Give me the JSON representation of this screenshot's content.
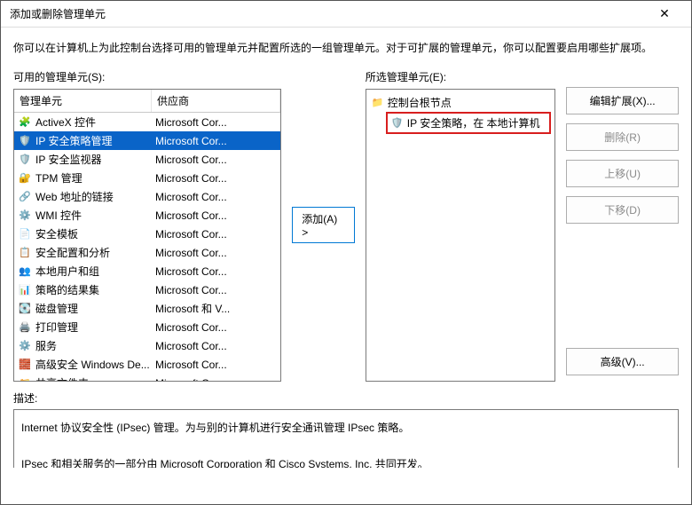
{
  "window": {
    "title": "添加或删除管理单元",
    "close_glyph": "✕"
  },
  "intro": "你可以在计算机上为此控制台选择可用的管理单元并配置所选的一组管理单元。对于可扩展的管理单元，你可以配置要启用哪些扩展项。",
  "left": {
    "label": "可用的管理单元(S):",
    "col_snapin": "管理单元",
    "col_vendor": "供应商",
    "items": [
      {
        "icon": "🧩",
        "name": "ActiveX 控件",
        "vendor": "Microsoft Cor..."
      },
      {
        "icon": "🛡️",
        "name": "IP 安全策略管理",
        "vendor": "Microsoft Cor...",
        "selected": true
      },
      {
        "icon": "🛡️",
        "name": "IP 安全监视器",
        "vendor": "Microsoft Cor..."
      },
      {
        "icon": "🔐",
        "name": "TPM 管理",
        "vendor": "Microsoft Cor..."
      },
      {
        "icon": "🔗",
        "name": "Web 地址的链接",
        "vendor": "Microsoft Cor..."
      },
      {
        "icon": "⚙️",
        "name": "WMI 控件",
        "vendor": "Microsoft Cor..."
      },
      {
        "icon": "📄",
        "name": "安全模板",
        "vendor": "Microsoft Cor..."
      },
      {
        "icon": "📋",
        "name": "安全配置和分析",
        "vendor": "Microsoft Cor..."
      },
      {
        "icon": "👥",
        "name": "本地用户和组",
        "vendor": "Microsoft Cor..."
      },
      {
        "icon": "📊",
        "name": "策略的结果集",
        "vendor": "Microsoft Cor..."
      },
      {
        "icon": "💽",
        "name": "磁盘管理",
        "vendor": "Microsoft 和 V..."
      },
      {
        "icon": "🖨️",
        "name": "打印管理",
        "vendor": "Microsoft Cor..."
      },
      {
        "icon": "⚙️",
        "name": "服务",
        "vendor": "Microsoft Cor..."
      },
      {
        "icon": "🧱",
        "name": "高级安全 Windows De...",
        "vendor": "Microsoft Cor..."
      },
      {
        "icon": "📁",
        "name": "共享文件夹",
        "vendor": "Microsoft Cor..."
      }
    ]
  },
  "add_button": "添加(A) >",
  "right": {
    "label": "所选管理单元(E):",
    "root_icon": "📁",
    "root": "控制台根节点",
    "child_icon": "🛡️",
    "child": "IP 安全策略，在 本地计算机"
  },
  "buttons": {
    "edit_ext": "编辑扩展(X)...",
    "remove": "删除(R)",
    "move_up": "上移(U)",
    "move_down": "下移(D)",
    "advanced": "高级(V)..."
  },
  "desc_label": "描述:",
  "desc_text": "Internet 协议安全性 (IPsec) 管理。为与别的计算机进行安全通讯管理 IPsec 策略。\n\nIPsec 和相关服务的一部分由 Microsoft Corporation 和 Cisco Systems, Inc. 共同开发。"
}
